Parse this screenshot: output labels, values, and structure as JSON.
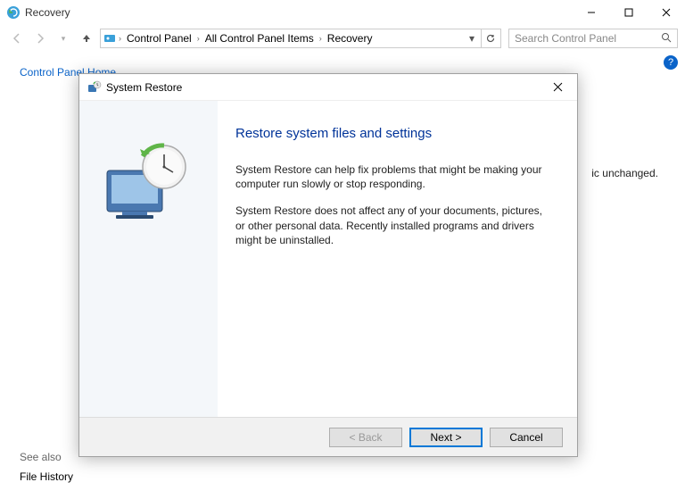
{
  "window": {
    "title": "Recovery",
    "controls_tooltips": {
      "min": "Minimize",
      "max": "Maximize",
      "close": "Close"
    }
  },
  "addressbar": {
    "crumbs": [
      "Control Panel",
      "All Control Panel Items",
      "Recovery"
    ],
    "search_placeholder": "Search Control Panel"
  },
  "sidebar": {
    "home": "Control Panel Home",
    "see_also": "See also",
    "file_history": "File History"
  },
  "background": {
    "peek_text": "ic unchanged."
  },
  "dialog": {
    "title": "System Restore",
    "heading": "Restore system files and settings",
    "paragraph1": "System Restore can help fix problems that might be making your computer run slowly or stop responding.",
    "paragraph2": "System Restore does not affect any of your documents, pictures, or other personal data. Recently installed programs and drivers might be uninstalled.",
    "buttons": {
      "back": "< Back",
      "next": "Next >",
      "cancel": "Cancel"
    }
  }
}
